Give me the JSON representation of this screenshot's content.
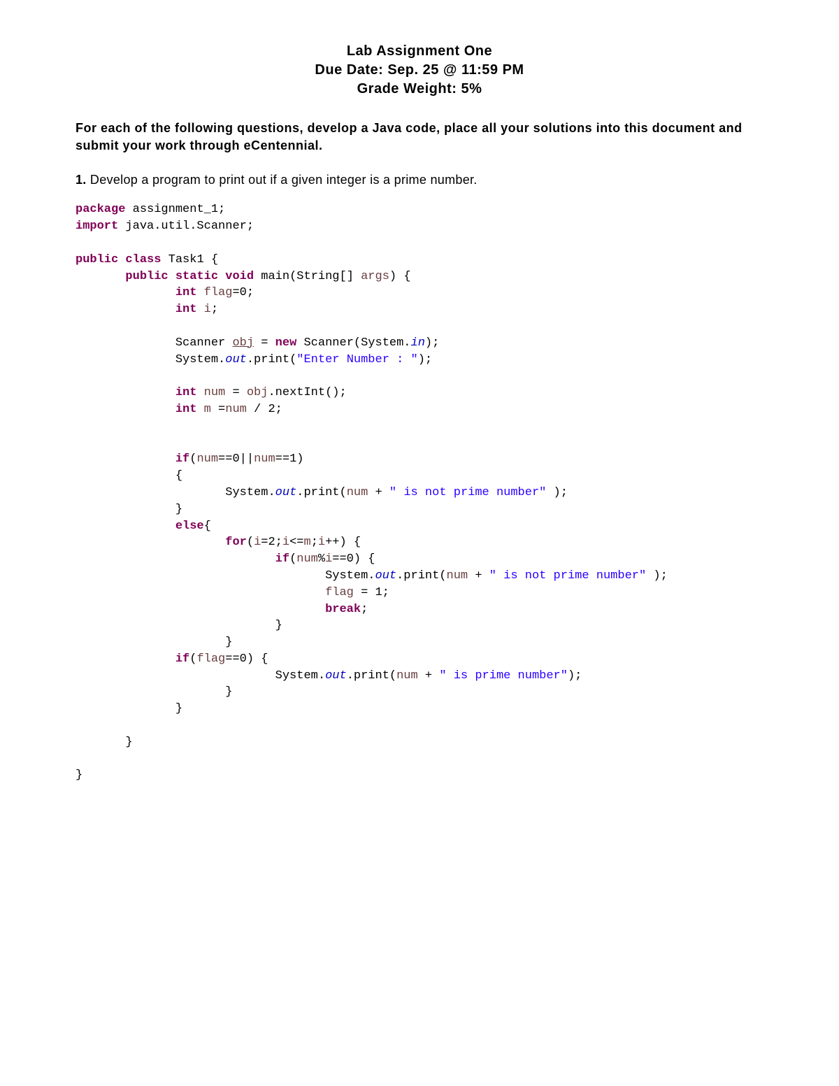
{
  "header": {
    "title": "Lab Assignment One",
    "due": "Due Date: Sep. 25 @ 11:59 PM",
    "weight": "Grade Weight: 5%"
  },
  "instructions": "For each of the following questions, develop a Java code, place all your solutions into this document and submit your work through eCentennial.",
  "question": {
    "num": "1.",
    "text": " Develop a program to print out if a given integer is a prime number."
  },
  "code": {
    "kw_package": "package",
    "pkg_name": " assignment_1;",
    "kw_import": "import",
    "import_name": " java.util.Scanner;",
    "kw_public1": "public",
    "kw_class": "class",
    "class_name": " Task1 {",
    "kw_public2": "public",
    "kw_static": "static",
    "kw_void": "void",
    "main_sig1": " main(String[] ",
    "param_args": "args",
    "main_sig2": ") {",
    "kw_int1": "int",
    "flag_decl": "=0;",
    "var_flag": "flag",
    "kw_int2": "int",
    "var_i": "i",
    "semicolon": ";",
    "scanner_type": "Scanner ",
    "var_obj": "obj",
    "eq_sp": " = ",
    "kw_new": "new",
    "scanner_ctor": " Scanner(System.",
    "field_in": "in",
    "close_paren_semi": ");",
    "system_out1": "System.",
    "field_out": "out",
    "print1": ".print(",
    "str_enter": "\"Enter Number : \"",
    "kw_int3": "int",
    "var_num": "num",
    "eq_obj": " = ",
    "obj_ref": "obj",
    "nextint": ".nextInt();",
    "kw_int4": "int",
    "var_m": "m",
    "eq_num": " =",
    "num_ref1": "num",
    "div2": " / 2;",
    "kw_if1": "if",
    "if_cond": "(",
    "num_ref2": "num",
    "eq0": "==0||",
    "num_ref3": "num",
    "eq1": "==1)",
    "open_brace": "{",
    "system_out2": "System.",
    "print2": ".print(",
    "num_ref4": "num",
    "plus1": " + ",
    "str_notprime": "\" is not prime number\"",
    "close_print": " );",
    "close_brace": "}",
    "kw_else": "else",
    "else_brace": "{",
    "kw_for": "for",
    "for_open": "(",
    "i_ref1": "i",
    "for_init": "=2;",
    "i_ref2": "i",
    "lte": "<=",
    "m_ref": "m",
    "for_semi": ";",
    "i_ref3": "i",
    "inc": "++) {",
    "kw_if2": "if",
    "if2_open": "(",
    "num_ref5": "num",
    "mod": "%",
    "i_ref4": "i",
    "eq0b": "==0) {",
    "system_out3": "System.",
    "print3": ".print(",
    "num_ref6": "num",
    "plus2": " + ",
    "str_notprime2": "\" is not prime number\"",
    "close_print2": " );",
    "flag_ref": "flag",
    "flag_assign": " = 1;",
    "kw_break": "break",
    "break_semi": ";",
    "kw_if3": "if",
    "if3_open": "(",
    "flag_ref2": "flag",
    "eq0c": "==0) {",
    "system_out4": "System.",
    "print4": ".print(",
    "num_ref7": "num",
    "plus3": " + ",
    "str_prime": "\" is prime number\"",
    "close_print3": ");"
  }
}
